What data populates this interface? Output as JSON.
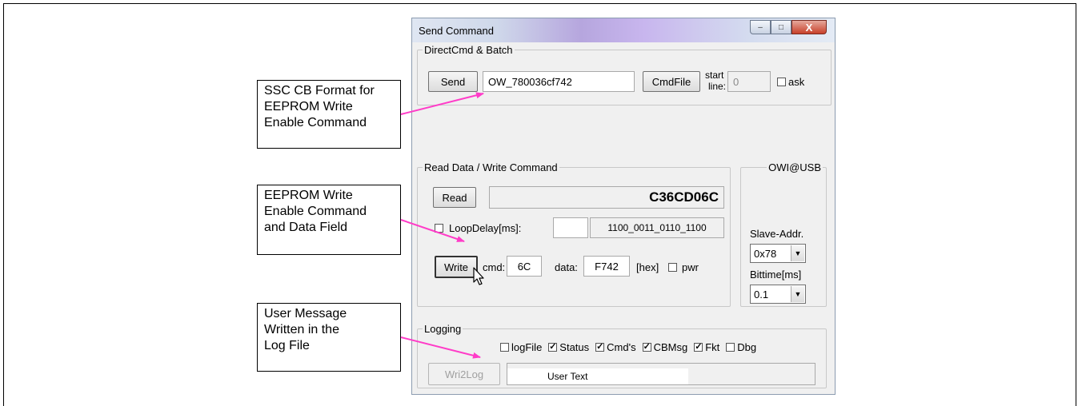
{
  "callouts": {
    "ssc_format": "SSC CB Format for\nEEPROM Write\nEnable Command",
    "write_enable": "EEPROM Write\nEnable Command\nand  Data Field",
    "user_message": "User Message\nWritten in the\nLog File"
  },
  "window": {
    "title": "Send Command",
    "minimize_glyph": "–",
    "maximize_glyph": "□",
    "close_glyph": "X"
  },
  "direct_cmd": {
    "legend": "DirectCmd & Batch",
    "send_label": "Send",
    "command_value": "OW_780036cf742",
    "cmdfile_label": "CmdFile",
    "start_line_label_1": "start",
    "start_line_label_2": "line:",
    "start_line_value": "0",
    "ask_label": "ask",
    "ask_checked": false
  },
  "read_write": {
    "legend": "Read Data / Write Command",
    "read_label": "Read",
    "read_value": "C36CD06C",
    "loopdelay_label": "LoopDelay[ms]:",
    "loopdelay_checked": false,
    "loopdelay_value": "",
    "binary_value": "1100_0011_0110_1100",
    "write_label": "Write",
    "cmd_label": "cmd:",
    "cmd_value": "6C",
    "data_label": "data:",
    "data_value": "F742",
    "hex_label": "[hex]",
    "pwr_label": "pwr",
    "pwr_checked": false
  },
  "owi": {
    "legend": "OWI@USB",
    "slave_addr_label": "Slave-Addr.",
    "slave_addr_value": "0x78",
    "bittime_label": "Bittime[ms]",
    "bittime_value": "0.1"
  },
  "logging": {
    "legend": "Logging",
    "options": [
      {
        "label": "logFile",
        "checked": false
      },
      {
        "label": "Status",
        "checked": true
      },
      {
        "label": "Cmd's",
        "checked": true
      },
      {
        "label": "CBMsg",
        "checked": true
      },
      {
        "label": "Fkt",
        "checked": true
      },
      {
        "label": "Dbg",
        "checked": false
      }
    ],
    "wri2log_label": "Wri2Log",
    "user_text": "User Text"
  },
  "colors": {
    "arrow": "#ff3cc8"
  }
}
